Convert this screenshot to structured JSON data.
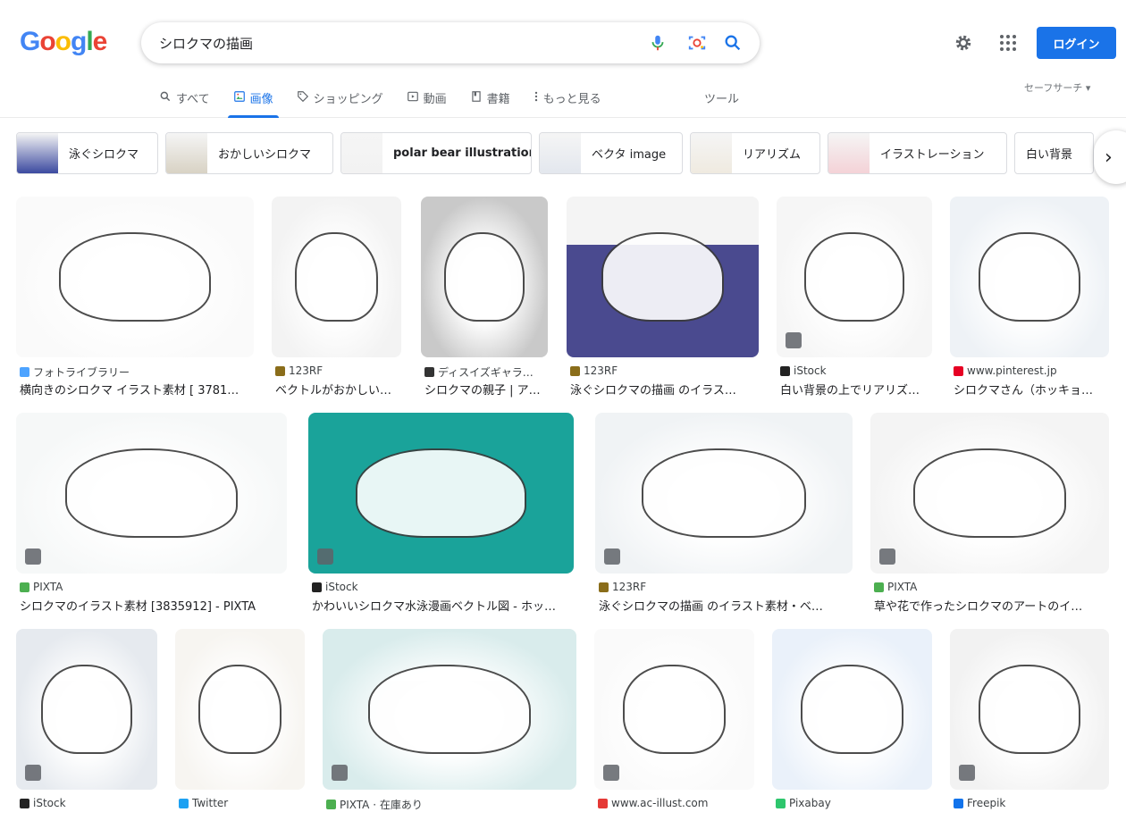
{
  "logo": "Google",
  "search": {
    "query": "シロクマの描画"
  },
  "header": {
    "login": "ログイン",
    "safe_search": "セーフサーチ ▾",
    "tools": "ツール"
  },
  "tabs": [
    {
      "label": "すべて",
      "icon": "search-icon"
    },
    {
      "label": "画像",
      "icon": "image-icon"
    },
    {
      "label": "ショッピング",
      "icon": "tag-icon"
    },
    {
      "label": "動画",
      "icon": "play-icon"
    },
    {
      "label": "書籍",
      "icon": "book-icon"
    },
    {
      "label": "もっと見る",
      "icon": "more-icon"
    }
  ],
  "chips": [
    "泳ぐシロクマ",
    "おかしいシロクマ",
    "polar bear illustration",
    "ベクタ image",
    "リアリズム",
    "イラストレーション",
    "白い背景"
  ],
  "results": [
    {
      "source": "フォトライブラリー",
      "caption": "横向きのシロクマ イラスト素材 [ 3781…",
      "fav_color": "#4da3ff"
    },
    {
      "source": "123RF",
      "caption": "ベクトルがおかしい…",
      "fav_color": "#8a6d1a"
    },
    {
      "source": "ディスイズギャラ…",
      "caption": "シロクマの親子 | ア…",
      "fav_color": "#333333"
    },
    {
      "source": "123RF",
      "caption": "泳ぐシロクマの描画 のイラス…",
      "fav_color": "#8a6d1a"
    },
    {
      "source": "iStock",
      "caption": "白い背景の上でリアリズ…",
      "fav_color": "#222222"
    },
    {
      "source": "www.pinterest.jp",
      "caption": "シロクマさん（ホッキョ…",
      "fav_color": "#e60023"
    },
    {
      "source": "PIXTA",
      "caption": "シロクマのイラスト素材 [3835912] - PIXTA",
      "fav_color": "#4caf50"
    },
    {
      "source": "iStock",
      "caption": "かわいいシロクマ水泳漫画ベクトル図 - ホッ…",
      "fav_color": "#222222"
    },
    {
      "source": "123RF",
      "caption": "泳ぐシロクマの描画 のイラスト素材・ベ…",
      "fav_color": "#8a6d1a"
    },
    {
      "source": "PIXTA",
      "caption": "草や花で作ったシロクマのアートのイ…",
      "fav_color": "#4caf50"
    },
    {
      "source": "iStock",
      "caption": "",
      "fav_color": "#222222"
    },
    {
      "source": "Twitter",
      "caption": "",
      "fav_color": "#1da1f2"
    },
    {
      "source": "PIXTA · 在庫あり",
      "caption": "",
      "fav_color": "#4caf50"
    },
    {
      "source": "www.ac-illust.com",
      "caption": "",
      "fav_color": "#e53935"
    },
    {
      "source": "Pixabay",
      "caption": "",
      "fav_color": "#2ec66d"
    },
    {
      "source": "Freepik",
      "caption": "",
      "fav_color": "#1273eb"
    }
  ],
  "colors": {
    "accent": "#1a73e8",
    "brand_blue": "#4285f4",
    "brand_red": "#ea4335",
    "brand_yellow": "#fbbc05",
    "brand_green": "#34a853"
  }
}
